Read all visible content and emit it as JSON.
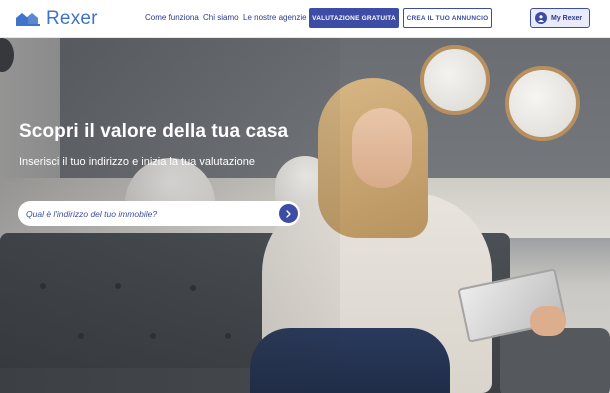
{
  "header": {
    "logo_text": "Rexer",
    "logo_icon": "house-roofs-icon",
    "nav": [
      {
        "label": "Come funziona"
      },
      {
        "label": "Chi siamo"
      },
      {
        "label": "Le nostre agenzie"
      }
    ],
    "primary_button": "VALUTAZIONE GRATUITA",
    "secondary_button": "CREA IL TUO ANNUNCIO",
    "account_button": "My Rexer",
    "account_icon": "user-avatar-icon"
  },
  "hero": {
    "title": "Scopri il valore della tua casa",
    "subtitle": "Inserisci il tuo indirizzo e inizia la tua valutazione",
    "search": {
      "placeholder": "Qual è l'indirizzo del tuo immobile?",
      "value": "",
      "submit_icon": "chevron-right-icon"
    }
  },
  "colors": {
    "brand": "#3d4da5",
    "logo": "#3e74c9",
    "account_bg": "#e9ebfb"
  }
}
